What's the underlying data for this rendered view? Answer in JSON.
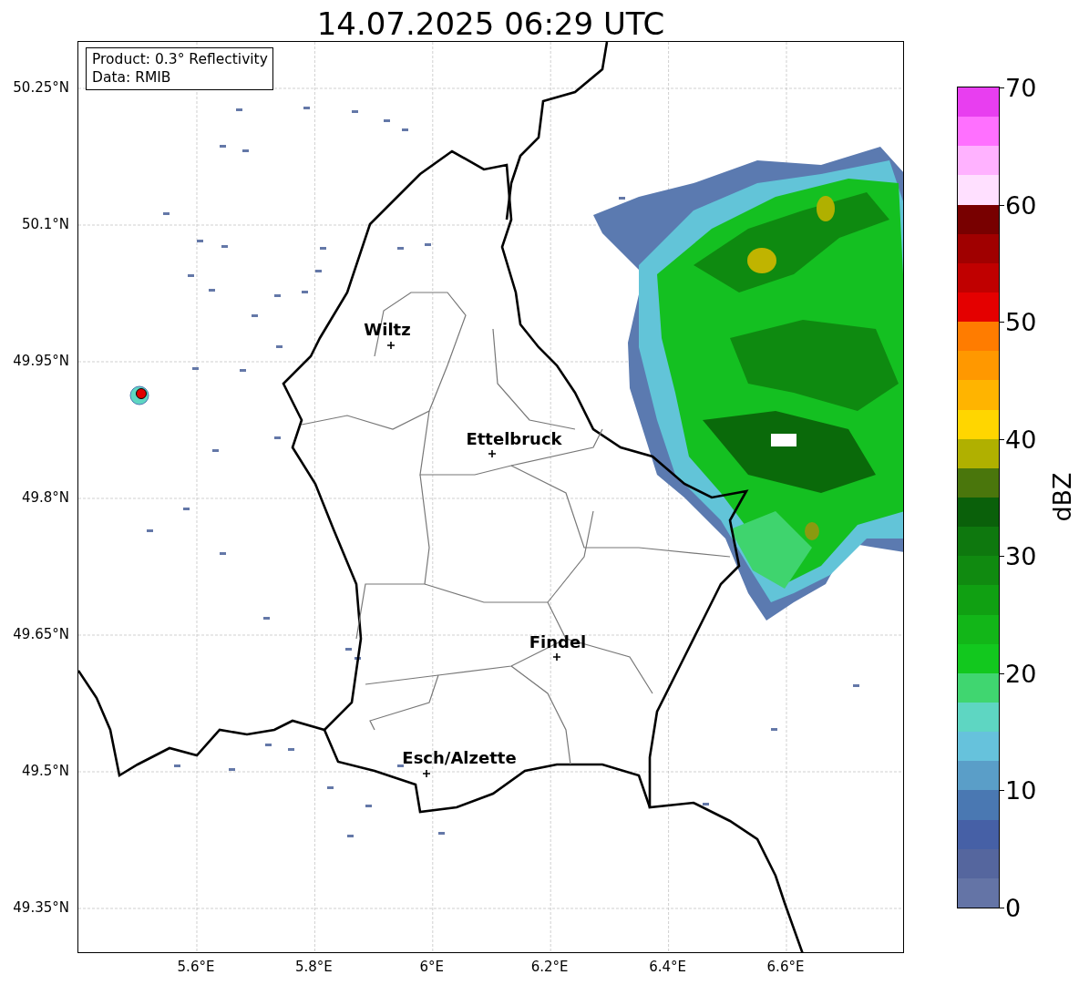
{
  "title": "14.07.2025 06:29 UTC",
  "info_box": {
    "lines": [
      "Product: 0.3° Reflectivity",
      "Data: RMIB"
    ]
  },
  "map": {
    "x_ticks": [
      "5.6°E",
      "5.8°E",
      "6°E",
      "6.2°E",
      "6.4°E",
      "6.6°E"
    ],
    "y_ticks": [
      "50.25°N",
      "50.1°N",
      "49.95°N",
      "49.8°N",
      "49.65°N",
      "49.5°N",
      "49.35°N"
    ],
    "cities": [
      {
        "name": "Wiltz"
      },
      {
        "name": "Ettelbruck"
      },
      {
        "name": "Findel"
      },
      {
        "name": "Esch/Alzette"
      }
    ]
  },
  "colorbar": {
    "label": "dBZ",
    "ticks": [
      "70",
      "60",
      "50",
      "40",
      "30",
      "20",
      "10",
      "0"
    ],
    "bands": [
      {
        "color": "#6474a6"
      },
      {
        "color": "#55669e"
      },
      {
        "color": "#4660a6"
      },
      {
        "color": "#4a78b2"
      },
      {
        "color": "#5a9ec8"
      },
      {
        "color": "#66c2dc"
      },
      {
        "color": "#5ed6c2"
      },
      {
        "color": "#40d670"
      },
      {
        "color": "#12c81e"
      },
      {
        "color": "#12b618"
      },
      {
        "color": "#10a012"
      },
      {
        "color": "#108a10"
      },
      {
        "color": "#0e780e"
      },
      {
        "color": "#0a600a"
      },
      {
        "color": "#4a760c"
      },
      {
        "color": "#b0b000"
      },
      {
        "color": "#ffd600"
      },
      {
        "color": "#ffb400"
      },
      {
        "color": "#ff9800"
      },
      {
        "color": "#ff7c00"
      },
      {
        "color": "#e40000"
      },
      {
        "color": "#c00000"
      },
      {
        "color": "#a00000"
      },
      {
        "color": "#780000"
      },
      {
        "color": "#ffe0ff"
      },
      {
        "color": "#ffb2ff"
      },
      {
        "color": "#ff70ff"
      },
      {
        "color": "#e83ef0"
      }
    ]
  }
}
